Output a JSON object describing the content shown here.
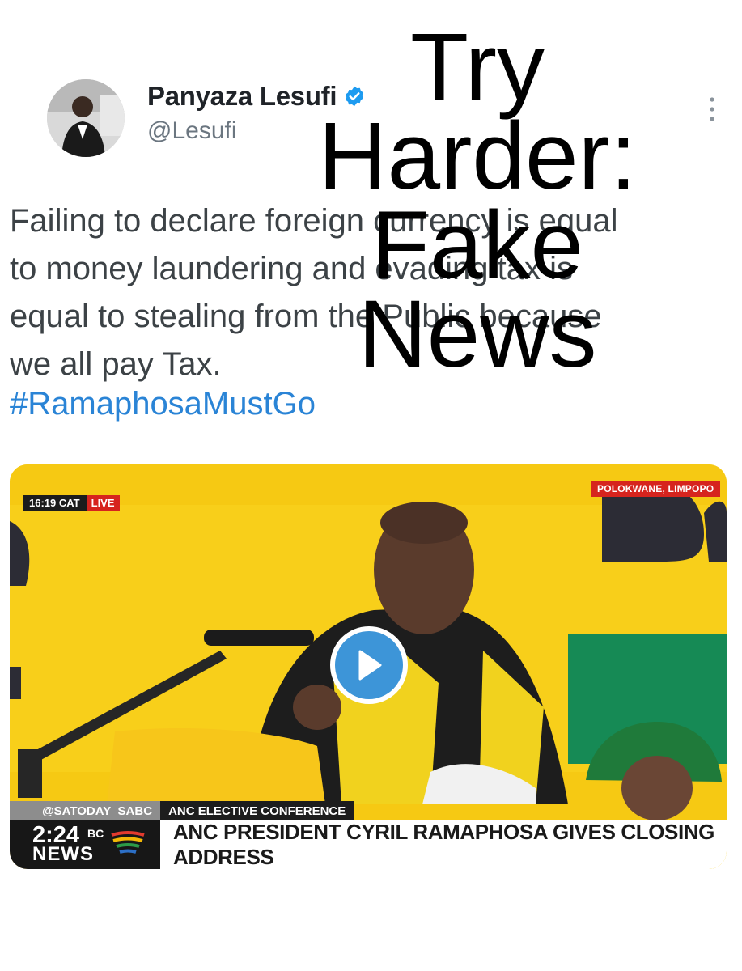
{
  "tweet": {
    "display_name": "Panyaza Lesufi",
    "handle": "@Lesufi",
    "verified_color": "#1d9bf0",
    "text": "Failing to declare foreign currency is equal\nto money laundering and evading tax is\nequal to stealing from the Public because\nwe all pay Tax.",
    "hashtag": "#RamaphosaMustGo"
  },
  "overlay": {
    "lines": [
      "Try",
      "Harder:",
      "Fake",
      "News"
    ]
  },
  "video": {
    "timestamp": "16:19 CAT",
    "live_label": "LIVE",
    "location": "POLOKWANE, LIMPOPO",
    "social_handle": "@SATODAY_SABC",
    "section_label": "ANC ELECTIVE CONFERENCE",
    "clock": "2:24",
    "channel_bc": "BC",
    "channel_news": "NEWS",
    "headline": "ANC PRESIDENT CYRIL RAMAPHOSA GIVES CLOSING ADDRESS",
    "background_color": "#f6c913",
    "play_color": "#3d95d8"
  }
}
